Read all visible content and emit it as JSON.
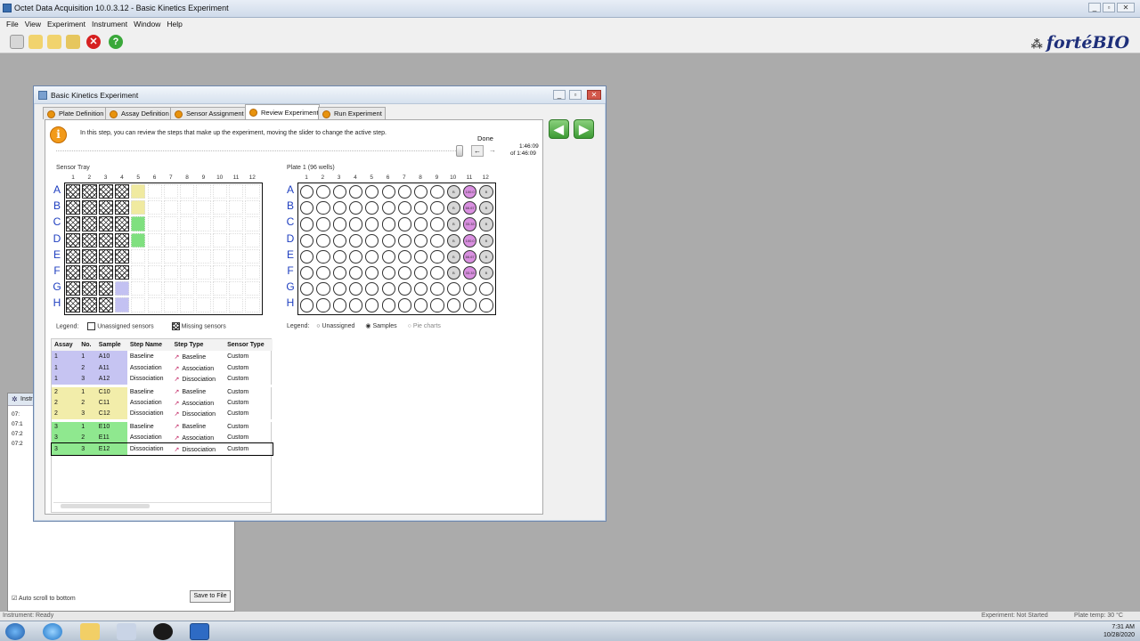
{
  "window": {
    "title": "Octet Data Acquisition 10.0.3.12 - Basic Kinetics Experiment"
  },
  "menu": [
    "File",
    "View",
    "Experiment",
    "Instrument",
    "Window",
    "Help"
  ],
  "brand": "fortéBIO",
  "dialog": {
    "title": "Basic Kinetics Experiment",
    "tabs": [
      "Plate Definition",
      "Assay Definition",
      "Sensor Assignment",
      "Review Experiment",
      "Run Experiment"
    ],
    "active_tab": "Review Experiment",
    "info_text": "In this step, you can review the steps that make up the experiment, moving the slider to change the active step.",
    "status": "Done",
    "time_current": "1:46:09",
    "time_of": "of",
    "time_total": "1:46:09",
    "back_button": "◀",
    "next_button": "▶"
  },
  "sensor_tray": {
    "title": "Sensor Tray",
    "rows": [
      "A",
      "B",
      "C",
      "D",
      "E",
      "F",
      "G",
      "H"
    ],
    "cols": [
      "1",
      "2",
      "3",
      "4",
      "5",
      "6",
      "7",
      "8",
      "9",
      "10",
      "11",
      "12"
    ],
    "legend_label": "Legend:",
    "legend_unassigned": "Unassigned sensors",
    "legend_missing": "Missing sensors",
    "colors": {
      "yellow": "#f0eaa0",
      "green": "#7fe07f",
      "lavender": "#c3c1f2"
    }
  },
  "plate": {
    "title": "Plate 1 (96 wells)",
    "rows": [
      "A",
      "B",
      "C",
      "D",
      "E",
      "F",
      "G",
      "H"
    ],
    "cols": [
      "1",
      "2",
      "3",
      "4",
      "5",
      "6",
      "7",
      "8",
      "9",
      "10",
      "11",
      "12"
    ],
    "legend_label": "Legend:",
    "legend_options": [
      "Unassigned",
      "Samples",
      "Pie charts"
    ],
    "legend_selected": "Samples",
    "buffer_mark": "B",
    "sample_labels": [
      "100.0",
      "66.67",
      "33.33",
      "100.0",
      "66.67",
      "33.33"
    ],
    "sample_color": "#d98fe0"
  },
  "steps_table": {
    "headers": [
      "Assay",
      "No.",
      "Sample",
      "Step Name",
      "Step Type",
      "Sensor Type"
    ],
    "rows": [
      {
        "assay": "1",
        "no": "1",
        "sample": "A10",
        "name": "Baseline",
        "type": "Baseline",
        "sensor": "Custom",
        "color": "#c6c4f2"
      },
      {
        "assay": "1",
        "no": "2",
        "sample": "A11",
        "name": "Association",
        "type": "Association",
        "sensor": "Custom",
        "color": "#c6c4f2"
      },
      {
        "assay": "1",
        "no": "3",
        "sample": "A12",
        "name": "Dissociation",
        "type": "Dissociation",
        "sensor": "Custom",
        "color": "#c6c4f2"
      },
      {
        "assay": "2",
        "no": "1",
        "sample": "C10",
        "name": "Baseline",
        "type": "Baseline",
        "sensor": "Custom",
        "color": "#f2edaa"
      },
      {
        "assay": "2",
        "no": "2",
        "sample": "C11",
        "name": "Association",
        "type": "Association",
        "sensor": "Custom",
        "color": "#f2edaa"
      },
      {
        "assay": "2",
        "no": "3",
        "sample": "C12",
        "name": "Dissociation",
        "type": "Dissociation",
        "sensor": "Custom",
        "color": "#f2edaa"
      },
      {
        "assay": "3",
        "no": "1",
        "sample": "E10",
        "name": "Baseline",
        "type": "Baseline",
        "sensor": "Custom",
        "color": "#8fe88f"
      },
      {
        "assay": "3",
        "no": "2",
        "sample": "E11",
        "name": "Association",
        "type": "Association",
        "sensor": "Custom",
        "color": "#8fe88f"
      },
      {
        "assay": "3",
        "no": "3",
        "sample": "E12",
        "name": "Dissociation",
        "type": "Dissociation",
        "sensor": "Custom",
        "color": "#8fe88f"
      }
    ]
  },
  "instrument_pane": {
    "title": "Instr",
    "log": [
      "07:",
      "07:1",
      "07:2",
      "07:2"
    ],
    "auto_scroll_label": "Auto scroll to bottom",
    "save_button": "Save to File"
  },
  "status_bar": {
    "left": "Instrument: Ready",
    "right1": "Experiment: Not Started",
    "right2": "Plate temp: 30 °C"
  },
  "clock": {
    "time": "7:31 AM",
    "date": "10/28/2020"
  }
}
